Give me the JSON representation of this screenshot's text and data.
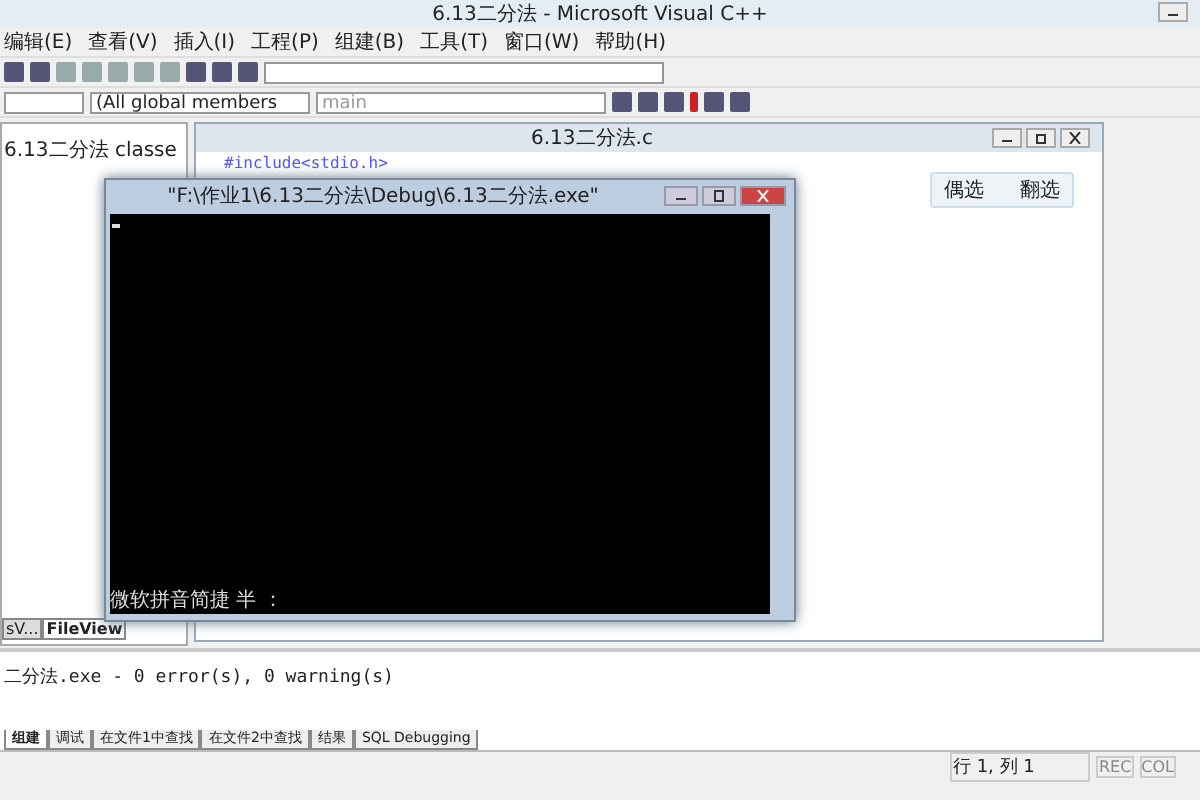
{
  "window": {
    "title": "6.13二分法 - Microsoft Visual C++"
  },
  "menu": [
    "编辑(E)",
    "查看(V)",
    "插入(I)",
    "工程(P)",
    "组建(B)",
    "工具(T)",
    "窗口(W)",
    "帮助(H)"
  ],
  "toolbar2": {
    "class_combo": "(All global members",
    "function_combo": "main"
  },
  "workspace": {
    "tree_item": "6.13二分法 classe",
    "tabs": [
      {
        "label": "sV...",
        "selected": false
      },
      {
        "label": "FileView",
        "selected": true
      }
    ]
  },
  "editor": {
    "title": "6.13二分法.c",
    "lines": [
      "#include<stdio.h>"
    ]
  },
  "ime_bar": {
    "items": [
      "偶选",
      "翻选"
    ]
  },
  "console": {
    "title": "\"F:\\作业1\\6.13二分法\\Debug\\6.13二分法.exe\"",
    "status_line": "微软拼音简捷 半 ："
  },
  "output": {
    "lines": [
      "二分法.exe - 0 error(s), 0 warning(s)"
    ],
    "tabs": [
      {
        "label": "组建",
        "selected": true
      },
      {
        "label": "调试",
        "selected": false
      },
      {
        "label": "在文件1中查找",
        "selected": false
      },
      {
        "label": "在文件2中查找",
        "selected": false
      },
      {
        "label": "结果",
        "selected": false
      },
      {
        "label": "SQL Debugging",
        "selected": false
      }
    ]
  },
  "status_bar": {
    "position": "行 1, 列 1",
    "indicators": [
      "REC",
      "COL"
    ]
  }
}
